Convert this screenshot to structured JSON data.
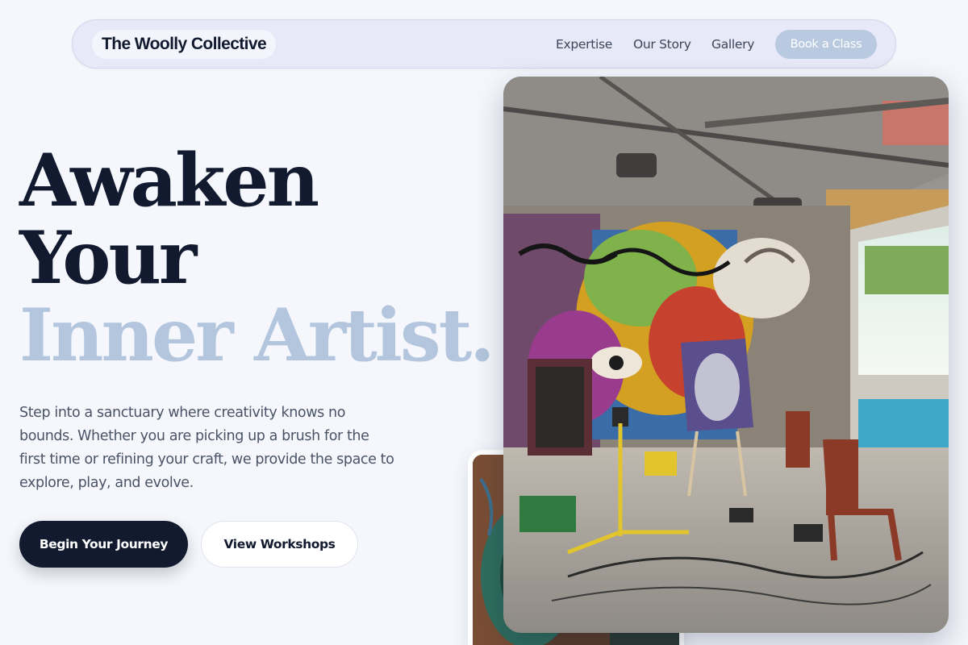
{
  "nav": {
    "brand": "The Woolly Collective",
    "links": [
      "Expertise",
      "Our Story",
      "Gallery"
    ],
    "cta": "Book a Class"
  },
  "hero": {
    "headline_line1": "Awaken",
    "headline_line2": "Your",
    "headline_line3": "Inner Artist.",
    "intro": "Step into a sanctuary where creativity knows no bounds. Whether you are picking up a brush for the first time or refining your craft, we provide the space to explore, play, and evolve.",
    "primary_button": "Begin Your Journey",
    "secondary_button": "View Workshops"
  },
  "images": {
    "main": "studio-photo",
    "secondary": "studio-detail-photo"
  },
  "colors": {
    "ink": "#111a2e",
    "accent": "#b3c6dd",
    "background": "#f5f7fc",
    "nav_background": "#e7e9f8",
    "cta": "#b8c9e0"
  }
}
